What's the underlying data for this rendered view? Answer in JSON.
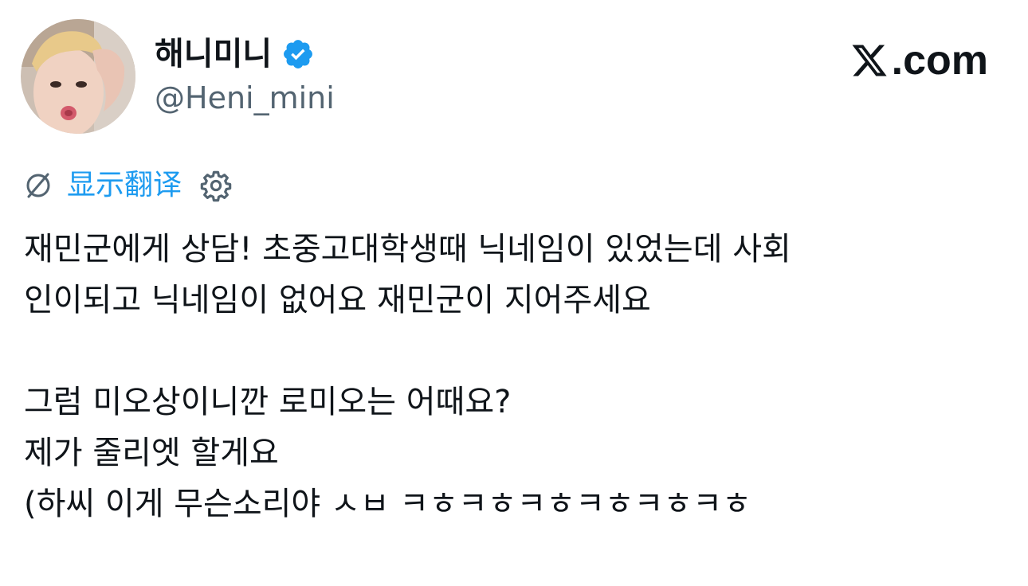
{
  "tweet": {
    "display_name": "해니미니",
    "handle": "@Heni_mini",
    "verified": true,
    "avatar_icon": "avatar-photo",
    "brand": {
      "logo_icon": "x-logo-icon",
      "text": ".com"
    },
    "translate": {
      "label": "显示翻译",
      "icon": "translate-icon",
      "settings_icon": "gear-icon"
    },
    "text_paragraphs": [
      [
        "재민군에게 상담! 초중고대학생때 닉네임이 있었는데 사회",
        "인이되고 닉네임이 없어요 재민군이 지어주세요"
      ],
      [
        "그럼 미오상이니깐 로미오는 어때요?",
        "제가 줄리엣 할게요",
        "(하씨 이게 무슨소리야 ㅅㅂ ㅋㅎㅋㅎㅋㅎㅋㅎㅋㅎㅋㅎ"
      ]
    ]
  },
  "colors": {
    "text": "#0f1419",
    "secondary": "#536471",
    "link": "#1d9bf0",
    "verified": "#1d9bf0",
    "background": "#ffffff"
  }
}
